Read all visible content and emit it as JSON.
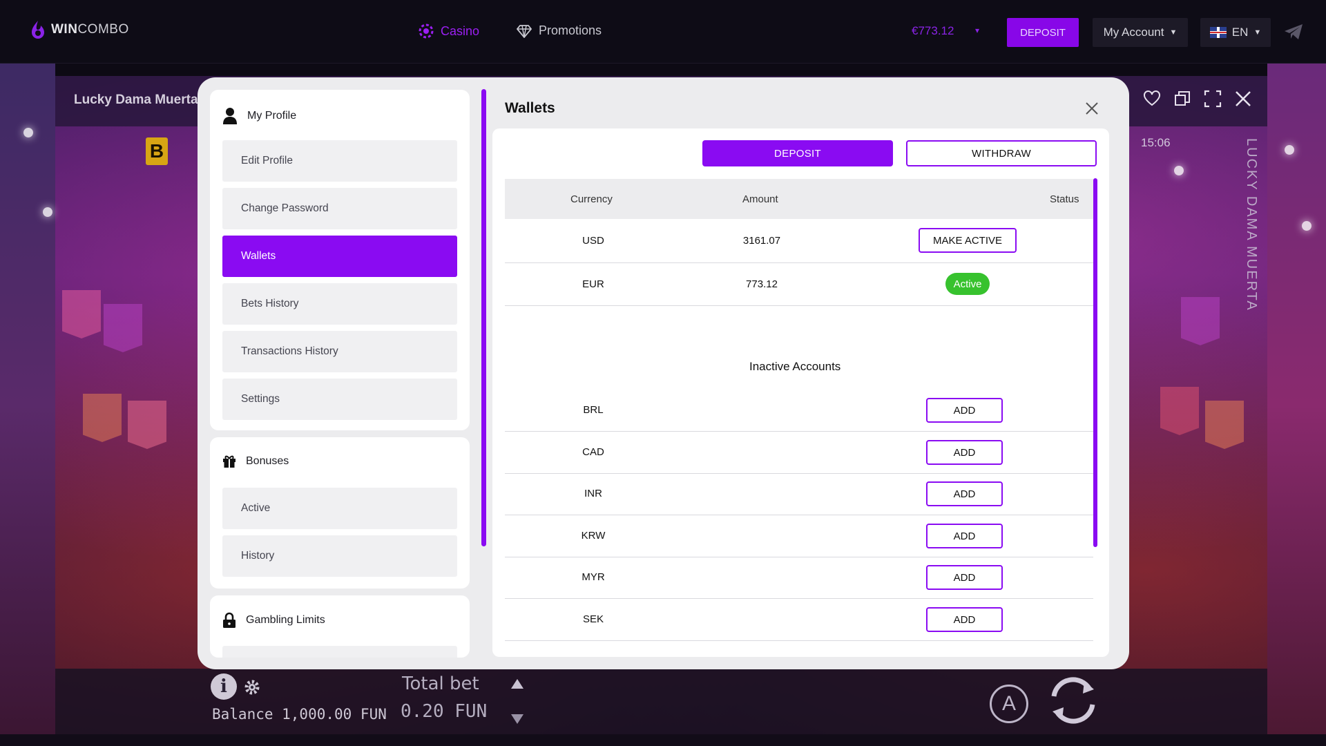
{
  "colors": {
    "accent": "#8a0bf2",
    "active_green": "#37c22e",
    "topbar_bg": "#0e0c16",
    "modal_bg": "#ececee"
  },
  "topbar": {
    "logo_bold": "WIN",
    "logo_light": "COMBO",
    "nav": [
      {
        "label": "Casino",
        "icon": "casino-chip-icon"
      },
      {
        "label": "Promotions",
        "icon": "diamond-icon"
      }
    ],
    "balance": "€773.12",
    "deposit_label": "DEPOSIT",
    "account_label": "My Account",
    "language": "EN"
  },
  "game": {
    "title": "Lucky Dama Muerta",
    "vertical_title": "LUCKY DAMA MUERTA",
    "badge": "B",
    "time": "15:06",
    "balance_text": "Balance 1,000.00 FUN",
    "total_bet_label": "Total bet",
    "total_bet_value": "0.20 FUN",
    "auto_label": "A"
  },
  "sidebar": {
    "profile": {
      "title": "My Profile",
      "items": [
        "Edit Profile",
        "Change Password",
        "Wallets",
        "Bets History",
        "Transactions History",
        "Settings"
      ],
      "active": "Wallets"
    },
    "bonuses": {
      "title": "Bonuses",
      "items": [
        "Active",
        "History"
      ]
    },
    "limits": {
      "title": "Gambling Limits"
    }
  },
  "wallets": {
    "title": "Wallets",
    "deposit_label": "DEPOSIT",
    "withdraw_label": "WITHDRAW",
    "columns": [
      "Currency",
      "Amount",
      "Status"
    ],
    "rows": [
      {
        "currency": "USD",
        "amount": "3161.07",
        "status_button": "MAKE ACTIVE"
      },
      {
        "currency": "EUR",
        "amount": "773.12",
        "status_badge": "Active"
      }
    ],
    "inactive_heading": "Inactive Accounts",
    "inactive": [
      {
        "currency": "BRL",
        "button": "ADD"
      },
      {
        "currency": "CAD",
        "button": "ADD"
      },
      {
        "currency": "INR",
        "button": "ADD"
      },
      {
        "currency": "KRW",
        "button": "ADD"
      },
      {
        "currency": "MYR",
        "button": "ADD"
      },
      {
        "currency": "SEK",
        "button": "ADD"
      }
    ]
  }
}
